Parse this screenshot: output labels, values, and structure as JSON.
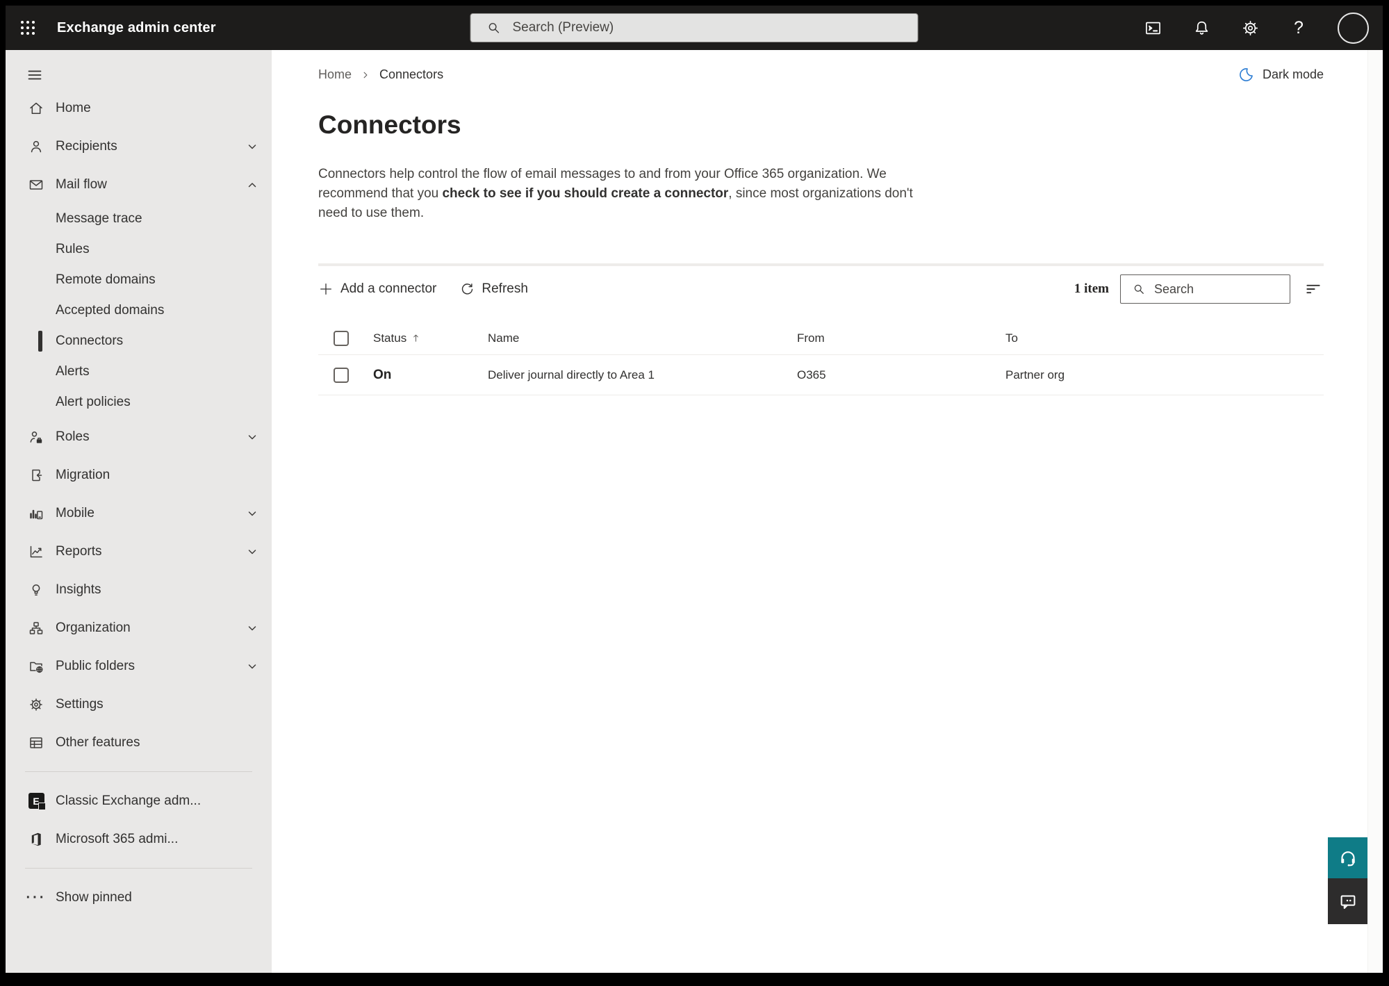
{
  "topbar": {
    "app_name": "Exchange admin center",
    "search_placeholder": "Search (Preview)",
    "icons": [
      "app-launcher",
      "terminal",
      "notifications",
      "settings",
      "help",
      "account"
    ]
  },
  "breadcrumb": {
    "home": "Home",
    "current": "Connectors"
  },
  "dark_mode_label": "Dark mode",
  "page": {
    "title": "Connectors",
    "description_part1": "Connectors help control the flow of email messages to and from your Office 365 organization. We recommend that you ",
    "description_emphasis": "check to see if you should create a connector",
    "description_part2": ", since most organizations don't need to use them."
  },
  "toolbar": {
    "add_label": "Add a connector",
    "refresh_label": "Refresh",
    "item_count": "1 item",
    "search_placeholder": "Search"
  },
  "table": {
    "columns": [
      "Status",
      "Name",
      "From",
      "To"
    ],
    "sorted_by": "Status",
    "sort_direction": "ascending",
    "rows": [
      {
        "status": "On",
        "name": "Deliver journal directly to Area 1",
        "from": "O365",
        "to": "Partner org"
      }
    ]
  },
  "sidebar": {
    "items": [
      {
        "label": "Home"
      },
      {
        "label": "Recipients",
        "expandable": true,
        "expanded": false
      },
      {
        "label": "Mail flow",
        "expandable": true,
        "expanded": true
      },
      {
        "label": "Message trace"
      },
      {
        "label": "Rules"
      },
      {
        "label": "Remote domains"
      },
      {
        "label": "Accepted domains"
      },
      {
        "label": "Connectors",
        "selected": true
      },
      {
        "label": "Alerts"
      },
      {
        "label": "Alert policies"
      },
      {
        "label": "Roles",
        "expandable": true,
        "expanded": false
      },
      {
        "label": "Migration"
      },
      {
        "label": "Mobile",
        "expandable": true,
        "expanded": false
      },
      {
        "label": "Reports",
        "expandable": true,
        "expanded": false
      },
      {
        "label": "Insights"
      },
      {
        "label": "Organization",
        "expandable": true,
        "expanded": false
      },
      {
        "label": "Public folders",
        "expandable": true,
        "expanded": false
      },
      {
        "label": "Settings"
      },
      {
        "label": "Other features"
      },
      {
        "label": "Classic Exchange adm..."
      },
      {
        "label": "Microsoft 365 admi..."
      },
      {
        "label": "Show pinned"
      }
    ]
  },
  "colors": {
    "topbar_bg": "#1d1c1b",
    "sidebar_bg": "#e9e8e7",
    "moon_blue": "#2b7cd3",
    "support_teal": "#0f7c87",
    "feedback_dark": "#2d2c2c"
  }
}
